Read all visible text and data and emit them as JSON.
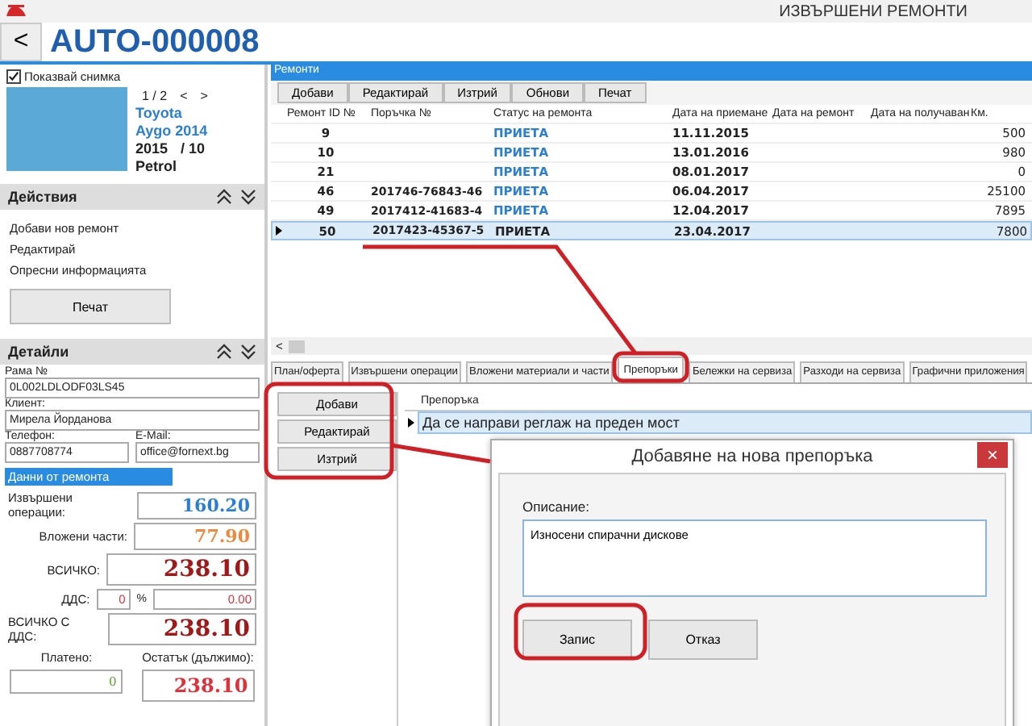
{
  "window": {
    "title": "ИЗВЪРШЕНИ РЕМОНТИ"
  },
  "header": {
    "back": "<",
    "record_id": "AUTO-000008"
  },
  "vehicle": {
    "show_photo": {
      "label": "Показвай снимка",
      "checked": true
    },
    "pager": "1 / 2",
    "prev": "<",
    "next": ">",
    "make": "Toyota",
    "model": "Aygo 2014",
    "year": "2015",
    "month": "/ 10",
    "fuel": "Petrol"
  },
  "actions": {
    "title": "Действия",
    "items": [
      "Добави нов ремонт",
      "Редактирай",
      "Опресни информацията"
    ],
    "print_button": "Печат"
  },
  "details": {
    "title": "Детайли",
    "fields": [
      {
        "label": "Рама №",
        "value": "0L002LDLODF03LS45"
      },
      {
        "label": "Клиент:",
        "value": "Мирела Йорданова"
      }
    ],
    "contacts": [
      {
        "label": "Телефон:",
        "value": "0887708774"
      },
      {
        "label": "E-Mail:",
        "value": "office@fornext.bg"
      }
    ],
    "repair_data_title": "Данни от ремонта",
    "amounts": [
      {
        "label": "Извършени операции:",
        "value": "160.20",
        "color": "#2a7fd4",
        "kind": "small"
      },
      {
        "label": "Вложени части:",
        "value": "77.90",
        "color": "#f0883a",
        "kind": "small"
      },
      {
        "label": "ВСИЧКО:",
        "value": "238.10",
        "color": "#a01818",
        "kind": "large"
      }
    ],
    "vat": {
      "label": "ДДС:",
      "percent": "0",
      "percent_sign": "%",
      "value": "0.00"
    },
    "total_with_vat": {
      "label": "ВСИЧКО С ДДС:",
      "value": "238.10"
    },
    "balance": [
      {
        "label": "Платено:",
        "value": "0",
        "color": "#5aa02c"
      },
      {
        "label": "Остатък (дължимо):",
        "value": "238.10",
        "color": "#e0303a"
      }
    ]
  },
  "repairs": {
    "title": "Ремонти",
    "toolbar": [
      "Добави",
      "Редактирай",
      "Изтрий",
      "Обнови",
      "Печат"
    ],
    "columns": [
      "Ремонт ID №",
      "Поръчка №",
      "Статус на ремонта",
      "Дата на приемане",
      "Дата на ремонт",
      "Дата на получаван",
      "Км."
    ],
    "rows": [
      {
        "id": "9",
        "order": "",
        "status": "ПРИЕТА",
        "received": "11.11.2015",
        "km": "500",
        "selected": false
      },
      {
        "id": "10",
        "order": "",
        "status": "ПРИЕТА",
        "received": "13.01.2016",
        "km": "980",
        "selected": false
      },
      {
        "id": "21",
        "order": "",
        "status": "ПРИЕТА",
        "received": "08.01.2017",
        "km": "0",
        "selected": false
      },
      {
        "id": "46",
        "order": "201746-76843-46",
        "status": "ПРИЕТА",
        "received": "06.04.2017",
        "km": "25100",
        "selected": false
      },
      {
        "id": "49",
        "order": "2017412-41683-4",
        "status": "ПРИЕТА",
        "received": "12.04.2017",
        "km": "7895",
        "selected": false
      },
      {
        "id": "50",
        "order": "2017423-45367-5",
        "status": "ПРИЕТА",
        "received": "23.04.2017",
        "km": "7800",
        "selected": true
      }
    ],
    "scroll_left": "<"
  },
  "tabs": [
    {
      "label": "План/оферта",
      "selected": false
    },
    {
      "label": "Извършени операции",
      "selected": false
    },
    {
      "label": "Вложени материали и части",
      "selected": false
    },
    {
      "label": "Препоръки",
      "selected": true
    },
    {
      "label": "Бележки на сервиза",
      "selected": false
    },
    {
      "label": "Разходи на сервиза",
      "selected": false
    },
    {
      "label": "Графични приложения",
      "selected": false
    }
  ],
  "recommendations": {
    "buttons": [
      "Добави",
      "Редактирай",
      "Изтрий"
    ],
    "column": "Препоръка",
    "rows": [
      {
        "text": "Да се направи реглаж на преден мост",
        "selected": true
      }
    ]
  },
  "dialog": {
    "title": "Добавяне на нова препоръка",
    "close": "×",
    "label": "Описание:",
    "value": "Износени спирачни дискове",
    "buttons": [
      "Запис",
      "Отказ"
    ]
  }
}
